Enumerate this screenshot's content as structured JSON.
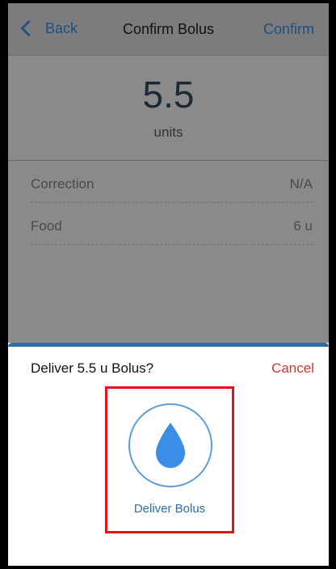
{
  "nav": {
    "back_label": "Back",
    "title": "Confirm Bolus",
    "confirm_label": "Confirm"
  },
  "summary": {
    "amount": "5.5",
    "unit": "units"
  },
  "rows": [
    {
      "label": "Correction",
      "value": "N/A"
    },
    {
      "label": "Food",
      "value": "6 u"
    }
  ],
  "sheet": {
    "title": "Deliver 5.5 u Bolus?",
    "cancel_label": "Cancel",
    "deliver_label": "Deliver Bolus"
  },
  "colors": {
    "accent": "#2d6ea7",
    "cancel": "#d9332e",
    "highlight": "#e0141a",
    "drop": "#3b8ee6"
  },
  "icons": {
    "back": "chevron-left-icon",
    "deliver": "water-drop-icon"
  }
}
